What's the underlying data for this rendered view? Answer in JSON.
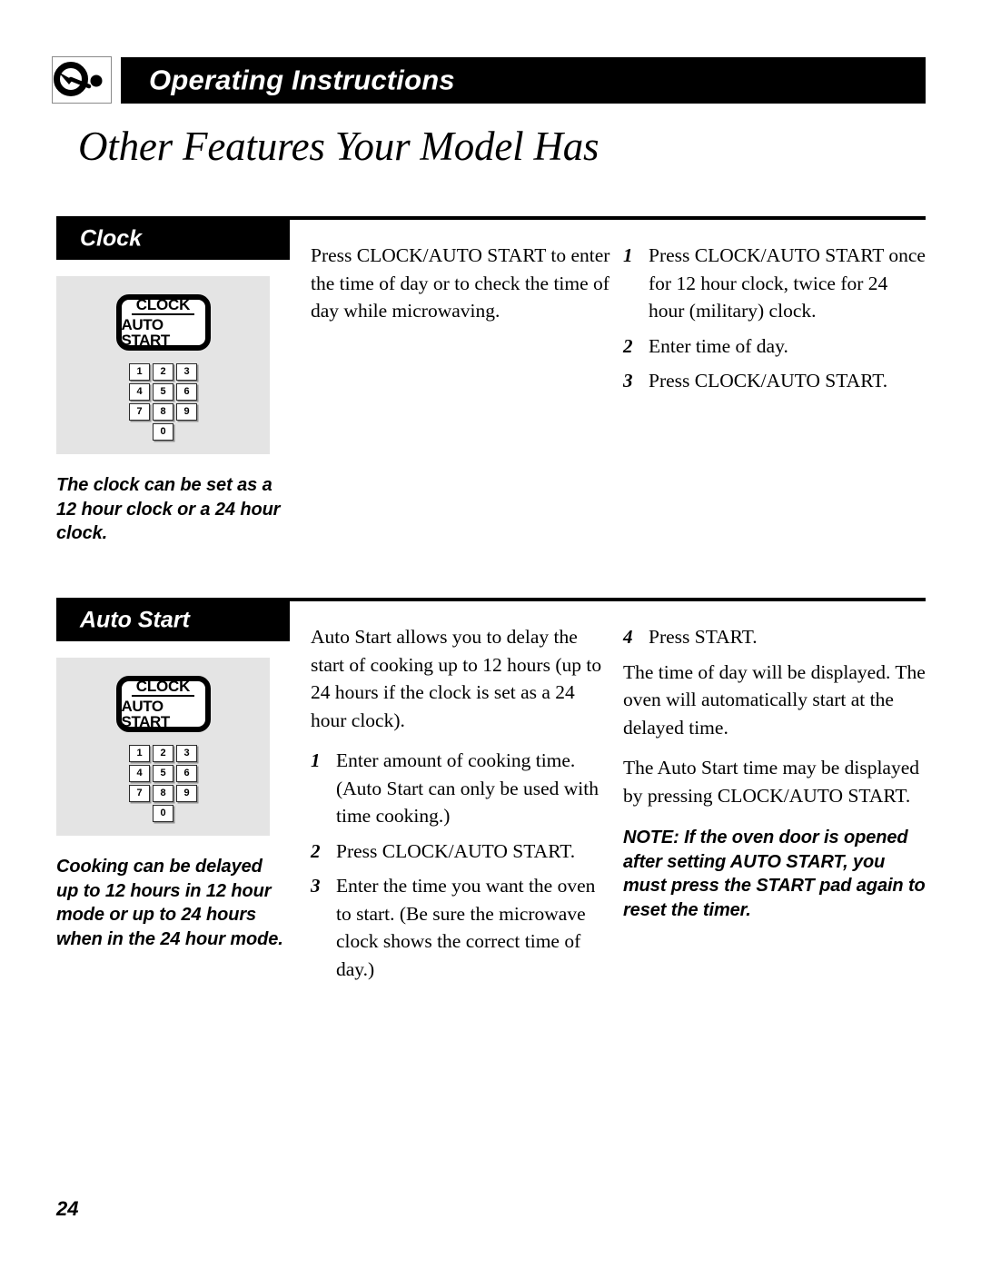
{
  "header": {
    "running_title": "Operating Instructions",
    "icon_name": "microwave-dial-icon"
  },
  "page_title": "Other Features Your Model Has",
  "page_number": "24",
  "colors": {
    "ink": "#000000",
    "panel_gray": "#e4e4e4",
    "paper": "#ffffff"
  },
  "keypad": {
    "button_top_label": "CLOCK",
    "button_bottom_label": "AUTO START",
    "rows": [
      [
        "1",
        "2",
        "3"
      ],
      [
        "4",
        "5",
        "6"
      ],
      [
        "7",
        "8",
        "9"
      ]
    ],
    "zero_key": "0"
  },
  "sections": [
    {
      "id": "clock",
      "heading": "Clock",
      "side_note": "The clock can be set as a 12 hour clock or a 24 hour clock.",
      "middle_column": {
        "intro": "Press CLOCK/AUTO START to enter the time of day or to check the time of day while microwaving."
      },
      "right_column": {
        "steps": [
          {
            "num": "1",
            "text": "Press CLOCK/AUTO START once for 12 hour clock, twice for 24 hour (military) clock."
          },
          {
            "num": "2",
            "text": "Enter time of day."
          },
          {
            "num": "3",
            "text": "Press CLOCK/AUTO START."
          }
        ]
      }
    },
    {
      "id": "autostart",
      "heading": "Auto Start",
      "side_note": "Cooking can be delayed up to 12 hours in 12 hour mode or up to 24 hours when in the 24 hour mode.",
      "middle_column": {
        "intro": "Auto Start allows you to delay the start of cooking up to 12 hours (up to 24 hours if the clock is set as a 24 hour clock).",
        "steps": [
          {
            "num": "1",
            "text": "Enter amount of cooking time. (Auto Start can only be used with time cooking.)"
          },
          {
            "num": "2",
            "text": "Press CLOCK/AUTO START."
          },
          {
            "num": "3",
            "text": "Enter the time you want the oven to start. (Be sure the microwave clock shows the correct time of day.)"
          }
        ]
      },
      "right_column": {
        "steps": [
          {
            "num": "4",
            "text": "Press START."
          }
        ],
        "paragraphs": [
          "The time of day will be displayed. The oven will automatically start at the delayed time.",
          "The Auto Start time may be displayed by pressing CLOCK/AUTO START."
        ],
        "note": "NOTE: If the oven door is opened after setting AUTO START, you must press the START pad again to reset the timer."
      }
    }
  ]
}
